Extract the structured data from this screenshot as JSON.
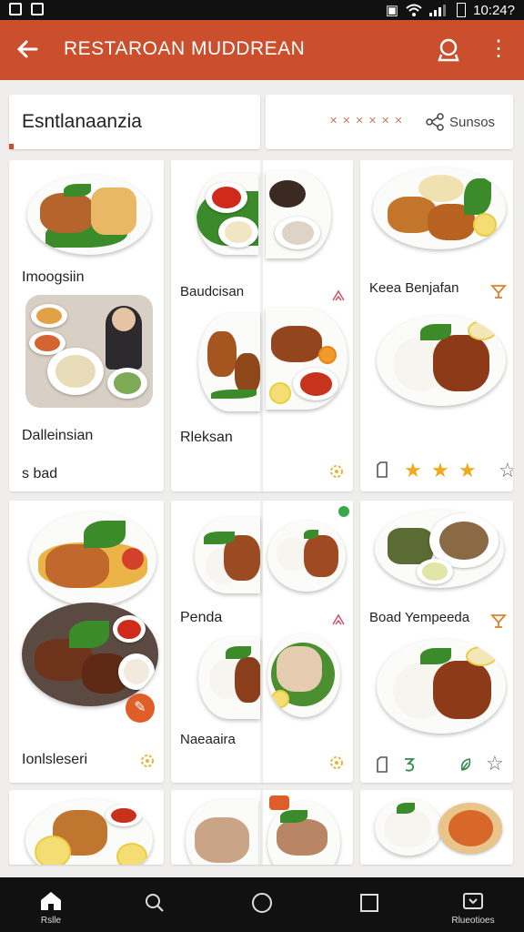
{
  "status": {
    "time": "10:24?"
  },
  "app": {
    "title": "RESTAROAN MUDDREAN"
  },
  "search": {
    "value": "Esntlanaanzia"
  },
  "filter": {
    "hint": "✕ ✕ ✕ ✕ ✕ ✕",
    "label": "Sunsos"
  },
  "cards": {
    "c1": {
      "label_top": "Imoogsiin",
      "label_bottom": "Dalleinsian",
      "label_extra": "s bad"
    },
    "c2": {
      "label_top": "Baudcisan",
      "label_bottom": "Rleksan"
    },
    "c3": {
      "label_top": "Keea Benjafan",
      "rating": 3,
      "rating_max": 4
    },
    "c4": {
      "label_bottom": "Ionlsleseri"
    },
    "c5": {
      "label_top": "Penda",
      "label_bottom": "Naeaaira"
    },
    "c6": {
      "label_top": "Boad Yempeeda"
    }
  },
  "nav": {
    "home": "Rslle",
    "tabs": "Rlueotioes"
  },
  "colors": {
    "accent": "#cb4f2d",
    "star": "#f0a81c"
  }
}
